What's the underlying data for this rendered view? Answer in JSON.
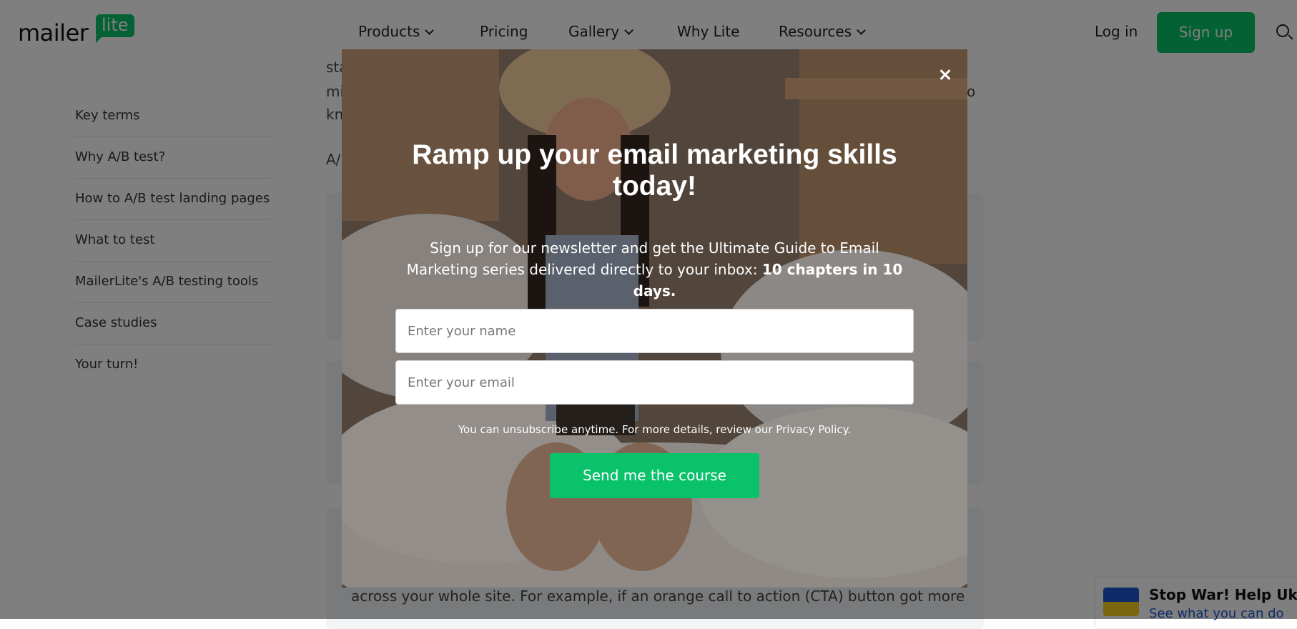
{
  "header": {
    "logo_word": "mailer",
    "logo_badge": "lite",
    "nav": [
      {
        "label": "Products",
        "dropdown": true
      },
      {
        "label": "Pricing",
        "dropdown": false
      },
      {
        "label": "Gallery",
        "dropdown": true
      },
      {
        "label": "Why Lite",
        "dropdown": false
      },
      {
        "label": "Resources",
        "dropdown": true
      }
    ],
    "login_label": "Log in",
    "signup_label": "Sign up",
    "search_icon": "search-icon"
  },
  "sidebar": {
    "items": [
      {
        "label": "Key terms"
      },
      {
        "label": "Why A/B test?"
      },
      {
        "label": "How to A/B test landing pages"
      },
      {
        "label": "What to test"
      },
      {
        "label": "MailerLite's A/B testing tools"
      },
      {
        "label": "Case studies"
      },
      {
        "label": "Your turn!"
      }
    ]
  },
  "article": {
    "fragments": [
      "sta",
      "mi",
      "kn",
      "A/",
      "o"
    ],
    "paragraph": "across your whole site. For example, if an orange call to action (CTA) button got more"
  },
  "modal": {
    "close_icon": "close-icon",
    "title": "Ramp up your email marketing skills today!",
    "subtitle_lead": "Sign up for our newsletter and get the Ultimate Guide to Email Marketing series delivered directly to your inbox: ",
    "subtitle_bold": "10 chapters in 10 days.",
    "name_placeholder": "Enter your name",
    "email_placeholder": "Enter your email",
    "legal": "You can unsubscribe anytime. For more details, review our Privacy Policy.",
    "cta_label": "Send me the course"
  },
  "ukraine_banner": {
    "title": "Stop War! Help Ukraine",
    "link": "See what you can do"
  },
  "colors": {
    "brand_green": "#09c269",
    "link_blue": "#1d57d1",
    "flag_blue": "#1d57d1",
    "flag_yellow": "#f4cc1e"
  }
}
